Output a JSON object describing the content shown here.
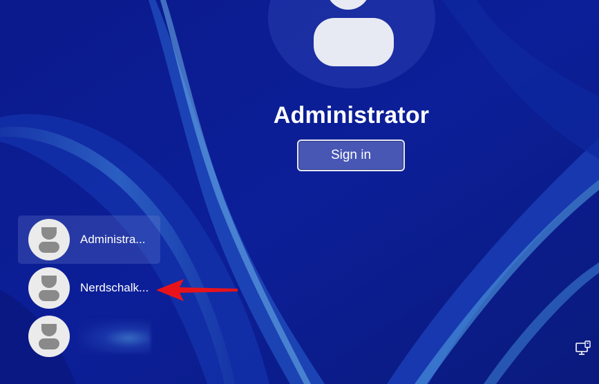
{
  "current_user": {
    "name": "Administrator",
    "sign_in_label": "Sign in"
  },
  "user_list": [
    {
      "label": "Administra...",
      "selected": true
    },
    {
      "label": "Nerdschalk...",
      "selected": false
    },
    {
      "label": "",
      "selected": false,
      "name_obscured": true
    }
  ],
  "annotation": {
    "type": "red-arrow",
    "points_to": "Nerdschalk..."
  },
  "icons": {
    "network": "network-icon",
    "user_avatar": "user-avatar-icon"
  },
  "colors": {
    "background": "#0a1a8a",
    "accent_ribbon": "#3b7fd6",
    "arrow": "#e8131a",
    "text": "#ffffff"
  }
}
